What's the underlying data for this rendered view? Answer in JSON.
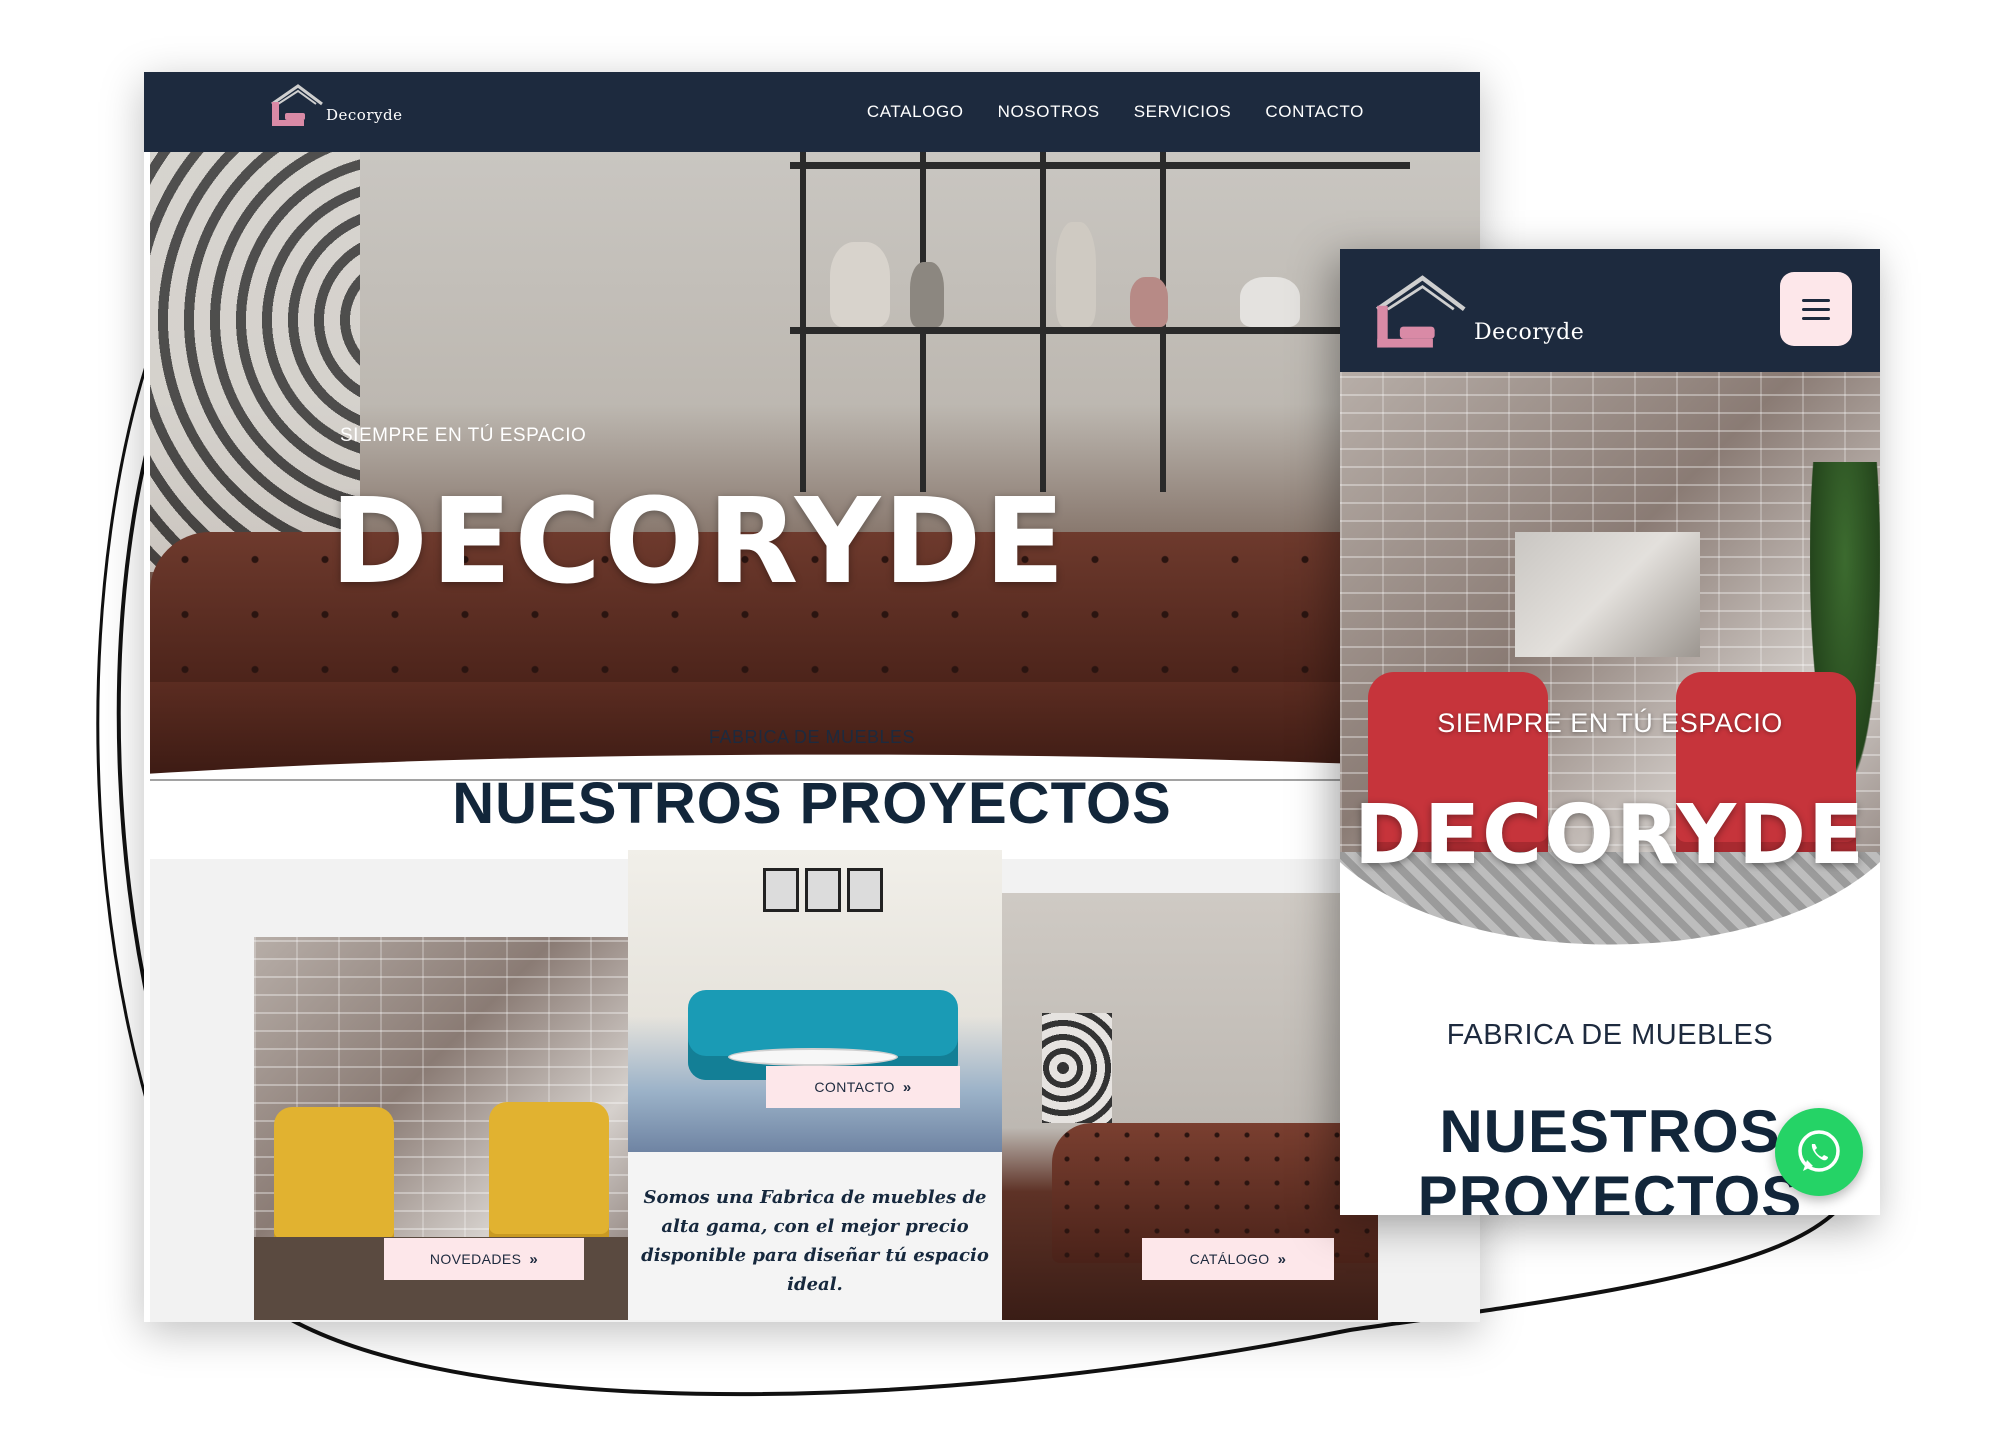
{
  "brand": {
    "name": "Decoryde",
    "colors": {
      "header": "#1d2a3e",
      "accent_pink": "#fde7ea",
      "title": "#12263a",
      "whatsapp": "#25d366"
    }
  },
  "desktop": {
    "nav": {
      "items": [
        {
          "label": "CATALOGO"
        },
        {
          "label": "NOSOTROS"
        },
        {
          "label": "SERVICIOS"
        },
        {
          "label": "CONTACTO"
        }
      ]
    },
    "hero": {
      "subtitle": "SIEMPRE EN TÚ ESPACIO",
      "title": "DECORYDE"
    },
    "section": {
      "kicker": "FABRICA DE MUEBLES",
      "title": "NUESTROS PROYECTOS"
    },
    "cards": {
      "contact_button": "CONTACTO",
      "news_button": "NOVEDADES",
      "catalog_button": "CATÁLOGO",
      "description": "Somos una Fabrica de muebles de alta gama, con el mejor precio disponible para diseñar tú espacio ideal."
    }
  },
  "mobile": {
    "menu_icon": "hamburger-icon",
    "hero": {
      "subtitle": "SIEMPRE EN TÚ ESPACIO",
      "title": "DECORYDE"
    },
    "section": {
      "kicker": "FABRICA DE MUEBLES",
      "title": "NUESTROS PROYECTOS"
    }
  },
  "whatsapp_icon": "whatsapp-icon"
}
